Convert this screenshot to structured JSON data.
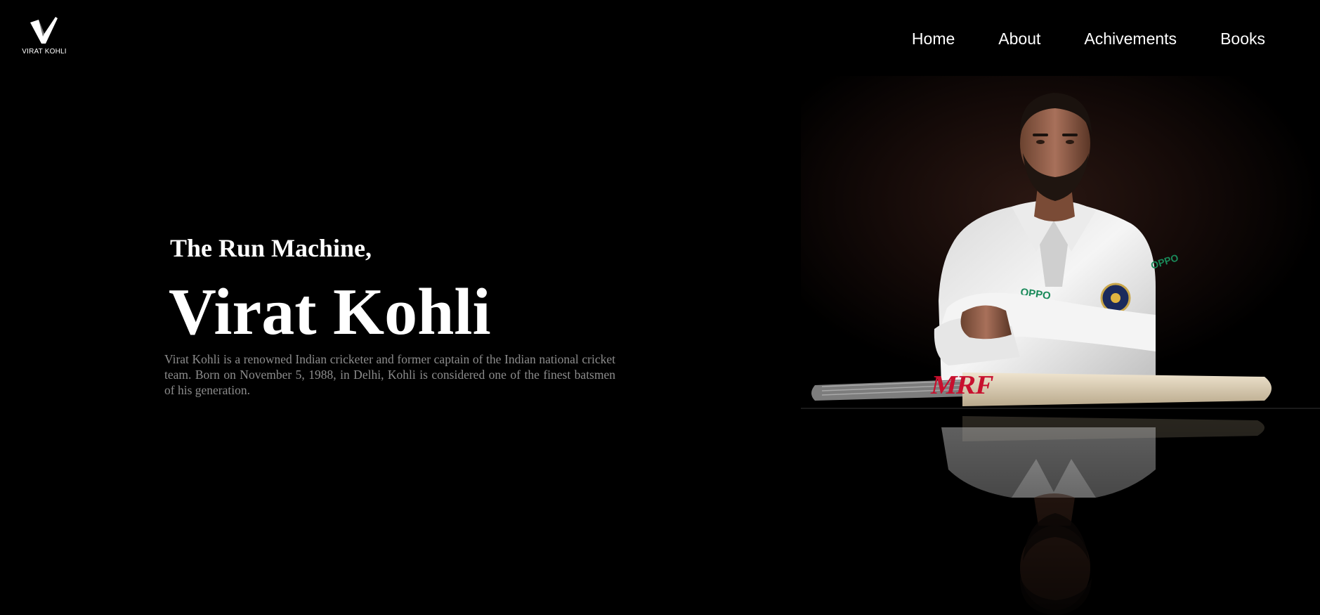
{
  "header": {
    "logo_text": "VIRAT KOHLI",
    "logo_icon": "v-checkmark-logo"
  },
  "nav": {
    "items": [
      "Home",
      "About",
      "Achivements",
      "Books"
    ]
  },
  "hero": {
    "tagline": "The Run Machine,",
    "name": "Virat Kohli",
    "description": "Virat Kohli is a renowned Indian cricketer and former captain of the Indian national cricket team. Born on November 5, 1988, in Delhi, Kohli is considered one of the finest batsmen of his generation."
  },
  "portrait": {
    "bat_brand": "MRF",
    "jersey_sponsor": "OPPO"
  },
  "colors": {
    "background": "#000000",
    "text": "#ffffff",
    "description_text": "#8c8c8c",
    "bat_logo": "#c8102e",
    "jersey": "#f2f2f2",
    "sponsor": "#1a8a5a"
  }
}
